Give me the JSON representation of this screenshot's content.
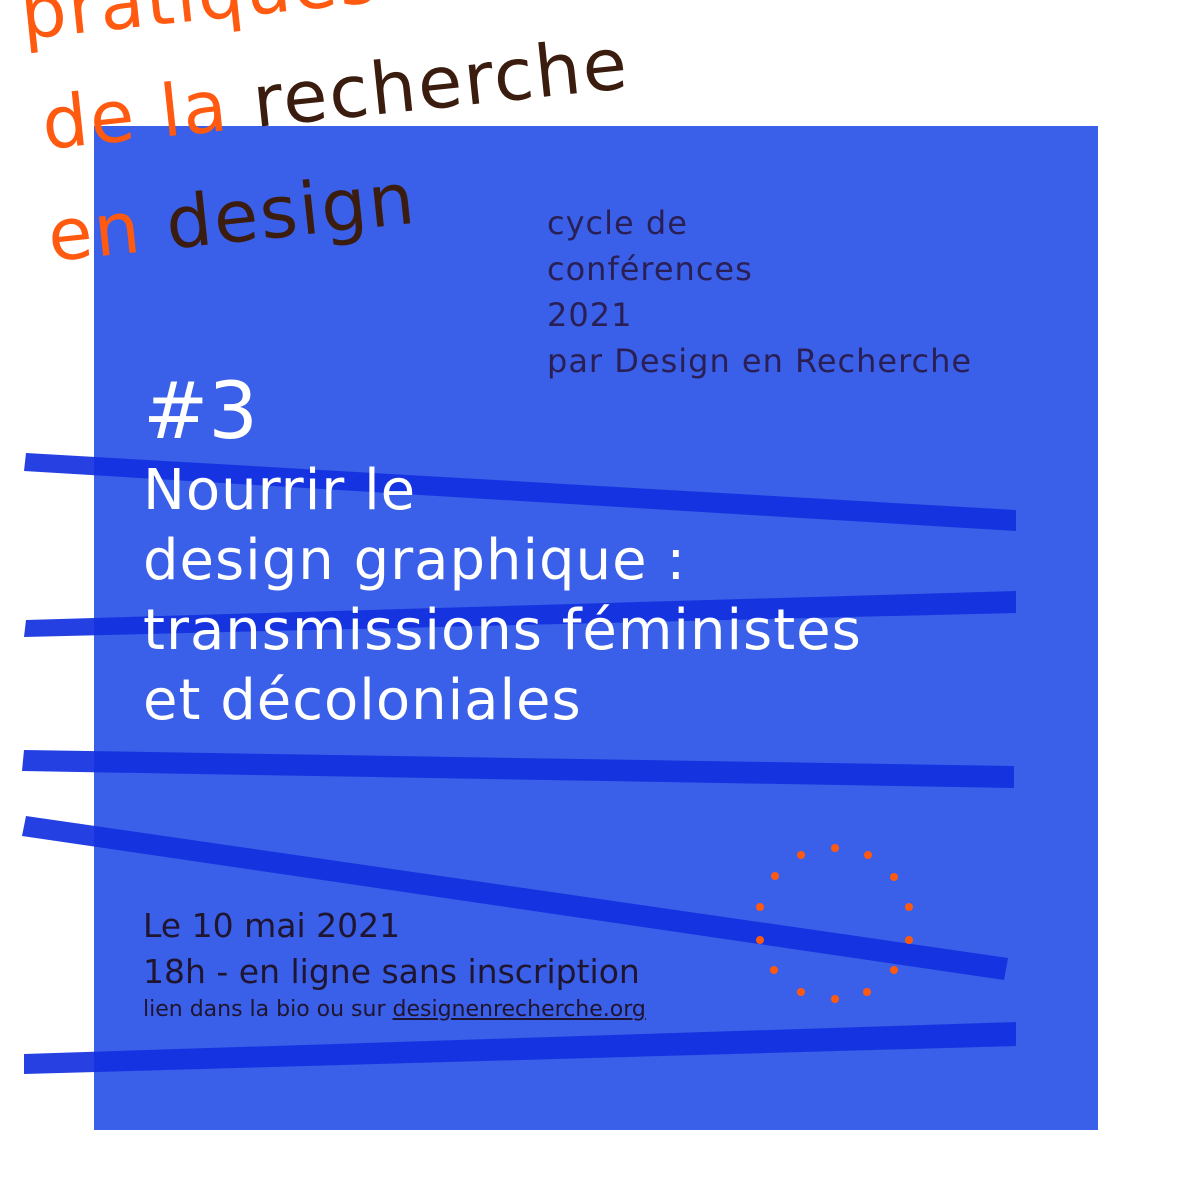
{
  "header": {
    "title_line1": "pratiques",
    "title_line2_a": "de la ",
    "title_line2_b": "recherche",
    "title_line3_a": "en ",
    "title_line3_b": "design"
  },
  "cycle": {
    "line1": "cycle de",
    "line2": "conférences",
    "line3": "2021",
    "line4": "par Design en Recherche"
  },
  "talk": {
    "number": "#3",
    "title_lines": [
      "Nourrir le",
      "design graphique :",
      "transmissions féministes",
      "et décoloniales"
    ]
  },
  "event": {
    "date": "Le 10 mai 2021",
    "time": "18h - en ligne sans inscription",
    "link_prefix": "lien dans la bio ou sur ",
    "link_url": "designenrecherche.org"
  },
  "colors": {
    "orange": "#ff5a0f",
    "dark_brown": "#3a1d0f",
    "panel_blue": "#3a5fe8",
    "stripe_blue": "#1330e0",
    "text_white": "#ffffff"
  },
  "icons": {
    "decorative": "dotted-circle-icon"
  }
}
